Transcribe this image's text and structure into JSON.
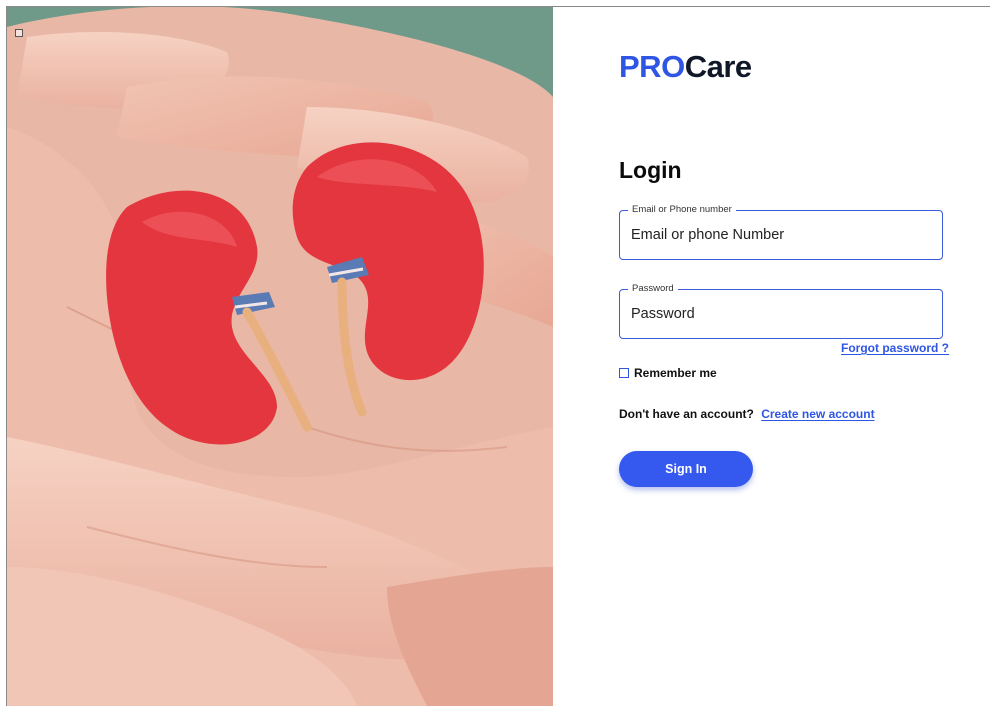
{
  "brand": {
    "part1": "PRO",
    "part2": "Care"
  },
  "login": {
    "title": "Login",
    "email": {
      "legend": "Email or Phone number",
      "placeholder": "Email or phone Number"
    },
    "password": {
      "legend": "Password",
      "placeholder": "Password"
    },
    "forgot_label": "Forgot password ?",
    "remember_label": "Remember me",
    "signup_prompt": "Don't have an account?",
    "signup_link": "Create new account",
    "signin_label": "Sign In"
  },
  "colors": {
    "accent": "#3558ef",
    "brand_dark": "#101828",
    "kidney_red": "#e3363f"
  },
  "hero": {
    "image": "kidney-paper-cutouts-in-hands"
  }
}
